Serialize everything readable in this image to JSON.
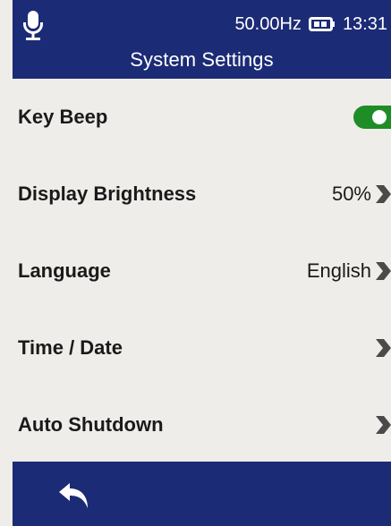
{
  "status_bar": {
    "frequency": "50.00Hz",
    "time": "13:31",
    "mic_icon": "microphone-icon",
    "battery_icon": "battery-icon"
  },
  "header": {
    "title": "System Settings"
  },
  "settings": [
    {
      "label": "Key Beep",
      "type": "toggle",
      "enabled": true
    },
    {
      "label": "Display Brightness",
      "value": "50%",
      "type": "chevron"
    },
    {
      "label": "Language",
      "value": "English",
      "type": "chevron"
    },
    {
      "label": "Time / Date",
      "value": "",
      "type": "chevron"
    },
    {
      "label": "Auto Shutdown",
      "value": "",
      "type": "chevron"
    }
  ],
  "footer": {
    "back_icon": "back-arrow-icon"
  },
  "colors": {
    "bar_background": "#1c2b76",
    "content_background": "#efedea",
    "toggle_on": "#1e8d26",
    "chevron": "#4a4a4a"
  }
}
